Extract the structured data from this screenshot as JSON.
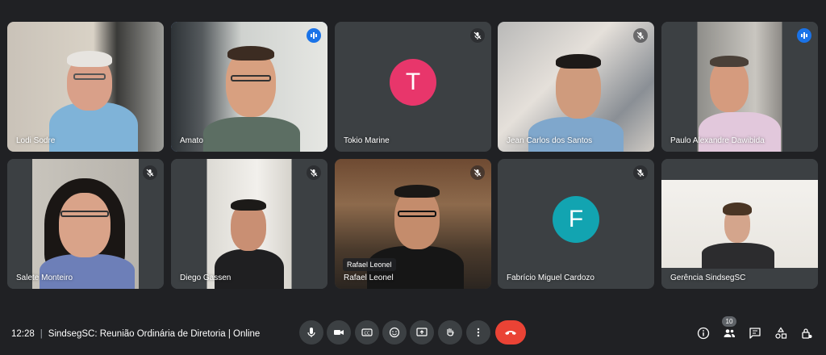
{
  "participants": [
    {
      "name": "Lodi Sodre"
    },
    {
      "name": "Amato"
    },
    {
      "name": "Tokio Marine",
      "initial": "T"
    },
    {
      "name": "Jean Carlos dos Santos"
    },
    {
      "name": "Paulo Alexandre Dawibida"
    },
    {
      "name": "Salete Monteiro"
    },
    {
      "name": "Diego Gassen"
    },
    {
      "name": "Rafael Leonel",
      "tooltip": "Rafael Leonel"
    },
    {
      "name": "Fabrício Miguel Cardozo",
      "initial": "F"
    },
    {
      "name": "Gerência SindsegSC"
    }
  ],
  "colors": {
    "background": "#202124",
    "tile": "#3c4043",
    "avatar_t": "#e8366b",
    "avatar_f": "#12a4b1",
    "end_call": "#ea4335",
    "speaking": "#1a73e8"
  },
  "bottom": {
    "time": "12:28",
    "separator": "|",
    "meeting_title": "SindsegSC: Reunião Ordinária de Diretoria | Online",
    "participants_count": "10"
  },
  "icons": [
    "mic-icon",
    "camera-icon",
    "captions-icon",
    "emoji-icon",
    "present-icon",
    "raise-hand-icon",
    "more-options-icon",
    "end-call-icon",
    "info-icon",
    "people-icon",
    "chat-icon",
    "activities-icon",
    "host-controls-icon"
  ]
}
